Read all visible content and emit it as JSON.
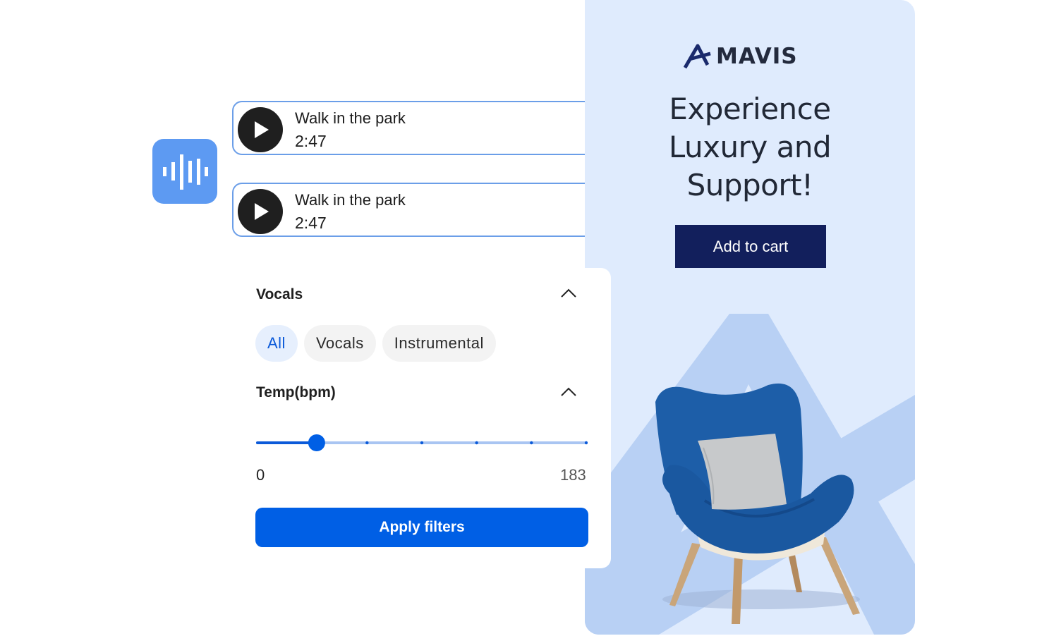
{
  "tracks": [
    {
      "title": "Walk in the park",
      "duration": "2:47"
    },
    {
      "title": "Walk in the park",
      "duration": "2:47"
    }
  ],
  "filters": {
    "vocals": {
      "title": "Vocals",
      "options": [
        "All",
        "Vocals",
        "Instrumental"
      ],
      "selected": "All"
    },
    "tempo": {
      "title": "Temp(bpm)",
      "min_label": "0",
      "max_label": "183",
      "value_fraction": 0.18,
      "tick_count": 6
    },
    "apply_label": "Apply filters"
  },
  "ad": {
    "brand": "MAVIS",
    "headline": [
      "Experience",
      "Luxury and",
      "Support!"
    ],
    "cta_label": "Add to cart"
  },
  "colors": {
    "accent": "#005fe5",
    "track_border": "#6b9ee8",
    "wave_tile": "#5d9af2",
    "ad_background": "#dfebfd",
    "ad_cta": "#121f5c",
    "chair_blue": "#1d5ea8"
  },
  "icons": {
    "wave": "sound-wave-icon",
    "play": "play-icon",
    "chevron": "chevron-up-icon",
    "logo": "mavis-logo-icon"
  }
}
